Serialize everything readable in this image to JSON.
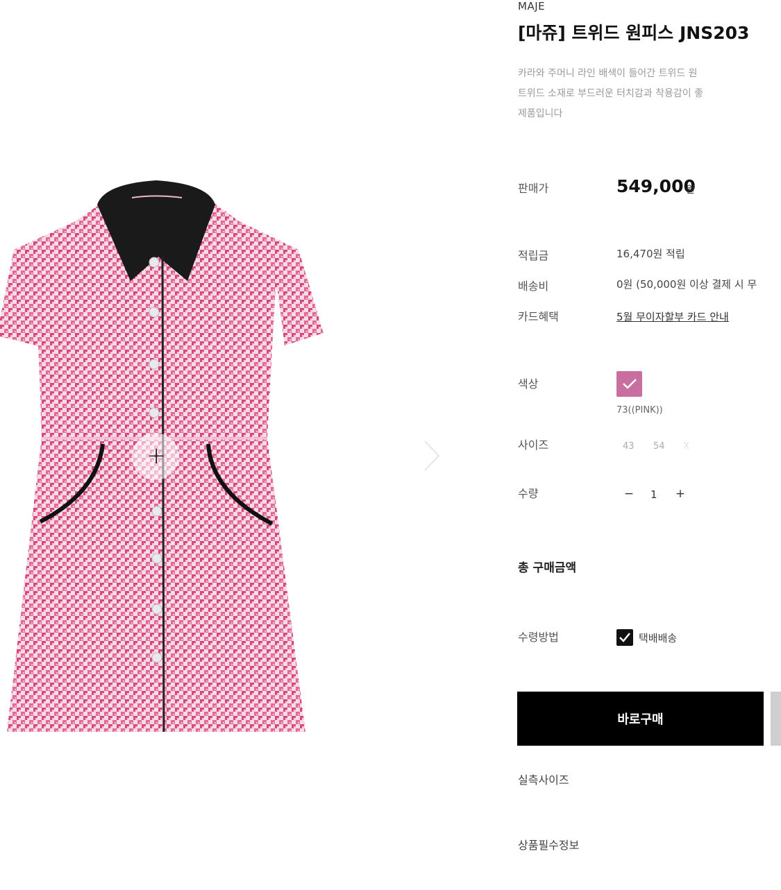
{
  "brand": "MAJE",
  "product": {
    "title": "[마쥬] 트위드 원피스 JNS203",
    "description": [
      "카라와 주머니 라인 배색이 들어간 트위드 원",
      "트위드 소재로 부드러운 터치감과 착용감이 좋",
      "제품입니다"
    ]
  },
  "price": {
    "label": "판매가",
    "amount": "549,000",
    "unit": "원"
  },
  "info": {
    "points_label": "적립금",
    "points_value": "16,470원 적립",
    "shipping_label": "배송비",
    "shipping_value": "0원 (50,000원 이상 결제 시 무",
    "card_label": "카드혜택",
    "card_value": "5월 무이자할부 카드 안내"
  },
  "options": {
    "color_label": "색상",
    "color_swatch": "#c96fa0",
    "color_name": "73((PINK))",
    "size_label": "사이즈",
    "sizes": [
      "43",
      "54",
      "X"
    ],
    "quantity_label": "수량",
    "quantity": "1",
    "minus": "−",
    "plus": "+"
  },
  "total_label": "총 구매금액",
  "delivery": {
    "label": "수령방법",
    "option": "택배배송"
  },
  "buttons": {
    "buy_now": "바로구매"
  },
  "links": {
    "size_info": "실측사이즈",
    "product_info": "상품필수정보"
  },
  "colors": {
    "dress_pink": "#d9477f",
    "collar": "#1a1a1a",
    "button_black": "#000000"
  },
  "icons": [
    "zoom-plus-icon",
    "chevron-right-icon",
    "checkmark-icon"
  ]
}
